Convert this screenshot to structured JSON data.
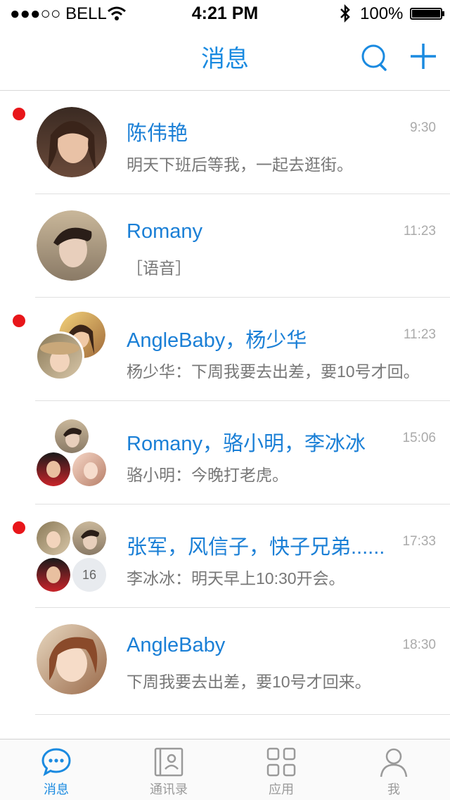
{
  "status_bar": {
    "carrier": "●●●○○ BELL",
    "time": "4:21 PM",
    "battery": "100%"
  },
  "nav": {
    "title": "消息"
  },
  "conversations": [
    {
      "name": "陈伟艳",
      "message": "明天下班后等我，一起去逛街。",
      "time": "9:30",
      "unread": true
    },
    {
      "name": "Romany",
      "message": "［语音］",
      "time": "11:23",
      "unread": false
    },
    {
      "name": "AngleBaby，杨少华",
      "message": "杨少华：下周我要去出差，要10号才回。",
      "time": "11:23",
      "unread": true
    },
    {
      "name": "Romany，骆小明，李冰冰",
      "message": "骆小明：今晚打老虎。",
      "time": "15:06",
      "unread": false
    },
    {
      "name": "张军，风信子，快子兄弟......",
      "message": "李冰冰：明天早上10:30开会。",
      "time": "17:33",
      "unread": true,
      "extra_count": "16"
    },
    {
      "name": "AngleBaby",
      "message": "下周我要去出差，要10号才回来。",
      "time": "18:30",
      "unread": false
    }
  ],
  "tabbar": {
    "tabs": [
      {
        "label": "消息",
        "icon": "chat-bubble-icon",
        "active": true
      },
      {
        "label": "通讯录",
        "icon": "contacts-icon",
        "active": false
      },
      {
        "label": "应用",
        "icon": "apps-grid-icon",
        "active": false
      },
      {
        "label": "我",
        "icon": "person-icon",
        "active": false
      }
    ]
  },
  "colors": {
    "accent": "#1a8ae0",
    "unread_dot": "#e8161a",
    "name": "#1a7fd6"
  }
}
